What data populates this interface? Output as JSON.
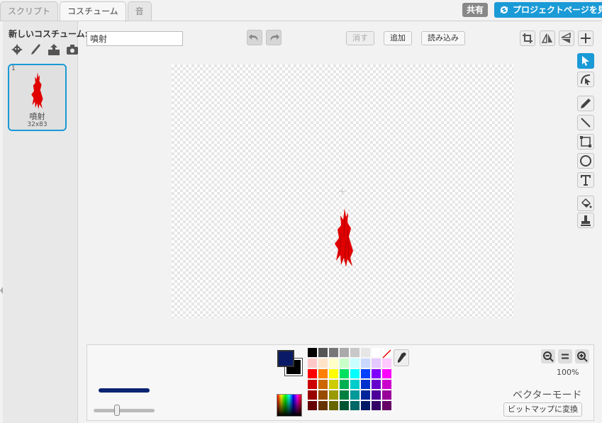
{
  "tabs": [
    {
      "label": "スクリプト",
      "active": false
    },
    {
      "label": "コスチューム",
      "active": true
    },
    {
      "label": "音",
      "active": false
    }
  ],
  "header": {
    "share_label": "共有",
    "project_page_label": "プロジェクトページを見る"
  },
  "sidebar": {
    "new_costume_label": "新しいコスチューム:",
    "new_costume_icons": [
      "character-library-icon",
      "paint-brush-icon",
      "upload-icon",
      "camera-icon"
    ],
    "costumes": [
      {
        "number": "1",
        "name": "噴射",
        "size": "32x83"
      }
    ]
  },
  "editor": {
    "costume_name_value": "噴射",
    "clear_label": "消す",
    "add_label": "追加",
    "import_label": "読み込み",
    "top_tools": [
      "crop-icon",
      "flip-horizontal-icon",
      "flip-vertical-icon",
      "set-center-icon"
    ],
    "right_tools": [
      "select-icon",
      "reshape-icon",
      "pencil-icon",
      "line-icon",
      "rectangle-icon",
      "ellipse-icon",
      "text-icon",
      "fill-icon",
      "stamp-icon"
    ],
    "selected_tool": "select-icon",
    "zoom_level": "100%",
    "mode_label": "ベクターモード",
    "convert_bitmap_label": "ビットマップに変換"
  },
  "colors": {
    "accent": "#1a9ad6",
    "foreground": "#0a1a66",
    "background": "#000000",
    "sprite_red": "#e00000",
    "palette": [
      "#000000",
      "#555555",
      "#777777",
      "#aaaaaa",
      "#c8c8c8",
      "#e6e6e6",
      "#ffffff",
      "none",
      "#ffc8c8",
      "#ffe4c8",
      "#ffffc8",
      "#c8ffc8",
      "#c8ffff",
      "#c8d8ff",
      "#e4c8ff",
      "#ffc8ff",
      "#ff0000",
      "#ff8000",
      "#ffff00",
      "#00e060",
      "#00ffff",
      "#0040ff",
      "#8000ff",
      "#ff00ff",
      "#cc0000",
      "#cc6600",
      "#cccc00",
      "#00b050",
      "#00cccc",
      "#0030cc",
      "#6600cc",
      "#cc00cc",
      "#990000",
      "#994c00",
      "#999900",
      "#008040",
      "#009999",
      "#002499",
      "#4c0099",
      "#990099",
      "#660000",
      "#663300",
      "#666600",
      "#005530",
      "#006666",
      "#001866",
      "#330066",
      "#660066"
    ]
  }
}
